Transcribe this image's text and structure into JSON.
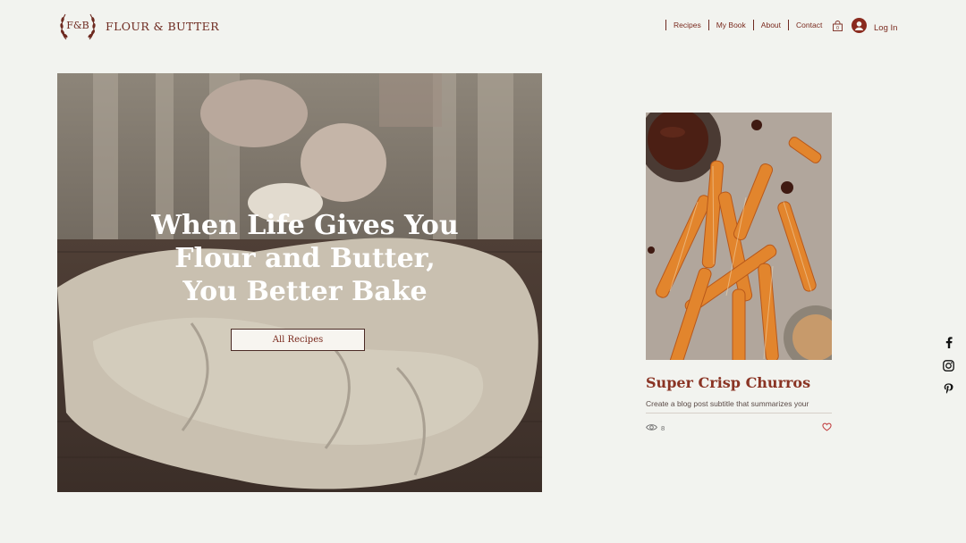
{
  "brand": {
    "monogram": "F&B",
    "name": "FLOUR & BUTTER"
  },
  "nav": {
    "items": [
      {
        "label": "Recipes"
      },
      {
        "label": "My Book"
      },
      {
        "label": "About"
      },
      {
        "label": "Contact"
      }
    ],
    "cart_count": "0",
    "login_label": "Log In"
  },
  "hero": {
    "title": "When Life Gives You\nFlour and Butter,\nYou Better Bake",
    "button_label": "All Recipes"
  },
  "post": {
    "title": "Super Crisp Churros",
    "subtitle": "Create a blog post subtitle that summarizes your",
    "views": "8"
  },
  "colors": {
    "accent": "#7a2a1e",
    "background": "#f2f3ef"
  },
  "social": [
    "facebook-icon",
    "instagram-icon",
    "pinterest-icon"
  ]
}
